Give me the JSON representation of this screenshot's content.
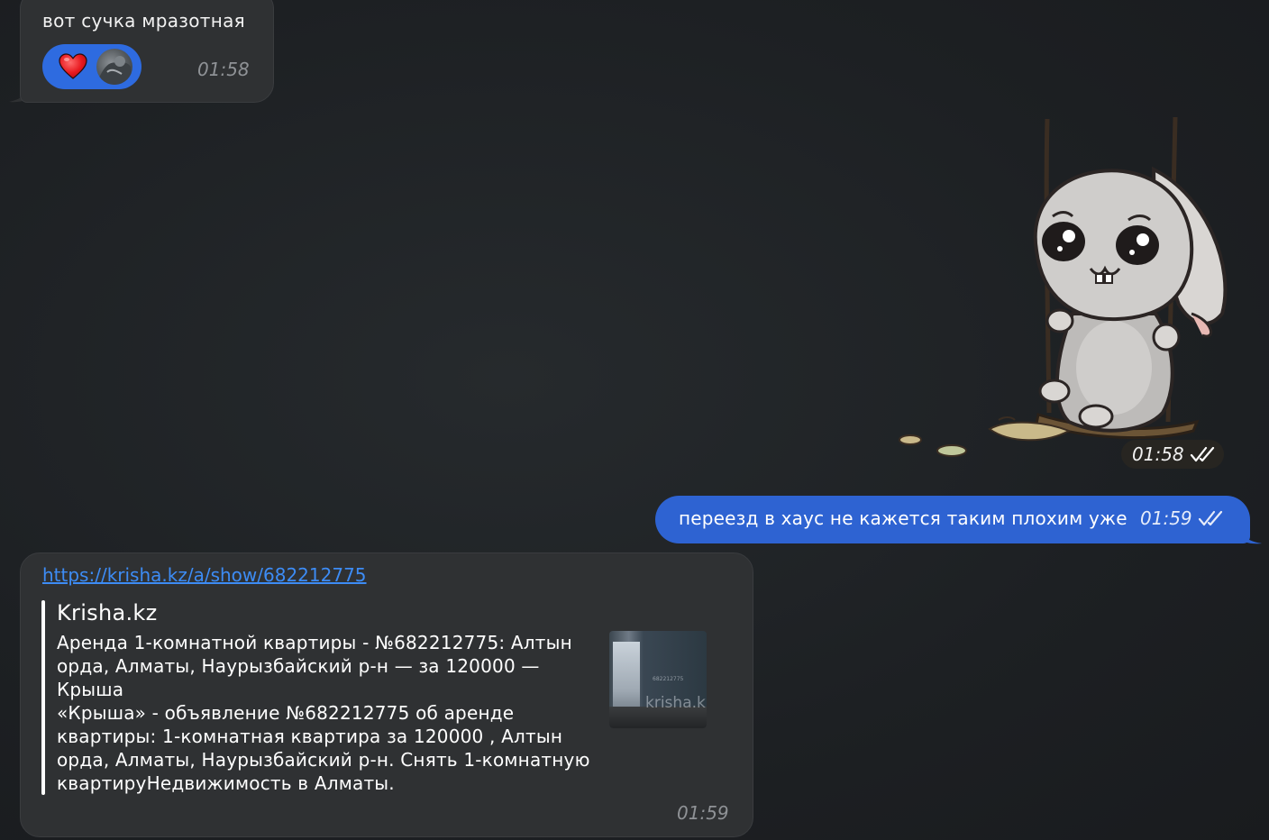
{
  "messages": {
    "incoming_1": {
      "text": "вот сучка мразотная",
      "time": "01:58",
      "reaction_icon": "heart-icon"
    },
    "sticker": {
      "time": "01:58",
      "icon": "bunny-on-swing-sticker",
      "status": "read-double-check-icon"
    },
    "outgoing_1": {
      "text": "переезд в хаус не кажется таким плохим уже",
      "time": "01:59",
      "status": "read-double-check-icon"
    },
    "incoming_2": {
      "url": "https://krisha.kz/a/show/682212775",
      "time": "01:59",
      "preview": {
        "site": "Krisha.kz",
        "title": "Аренда 1-комнатной квартиры - №682212775: Алтын орда, Алматы, Наурызбайский р-н — за 120000 — Крыша",
        "description": "«Крыша» - объявление №682212775 об аренде квартиры: 1-комнатная квартира за 120000 , Алтын орда, Алматы, Наурызбайский р-н. Снять 1-комнатную квартируНедвижимость в Алматы.",
        "thumb_watermark": "krisha.k",
        "thumb_id": "682212775"
      }
    }
  },
  "colors": {
    "background": "#1e2124",
    "incoming_bubble": "#2f3133",
    "outgoing_bubble": "#2e63d2",
    "reaction_pill": "#2e6be0",
    "link": "#3d8cf5",
    "timestamp_incoming": "#8f9296"
  }
}
